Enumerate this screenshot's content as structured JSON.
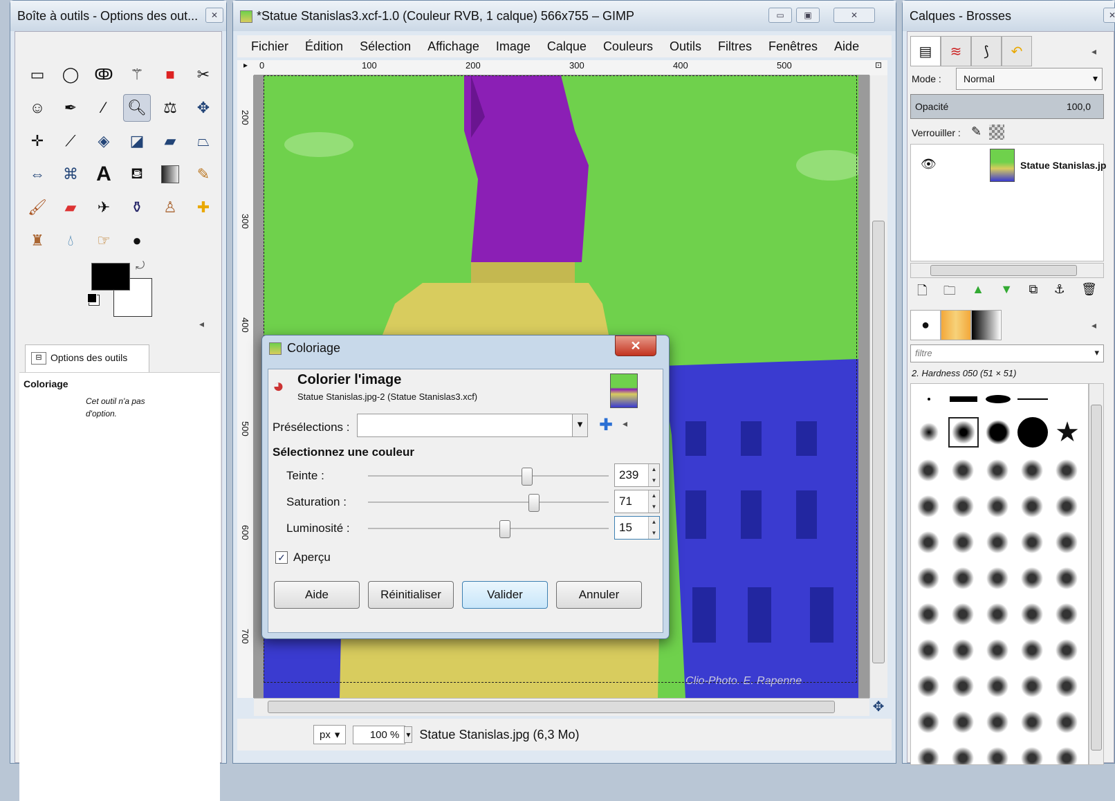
{
  "toolbox": {
    "title": "Boîte à outils - Options des out...",
    "tool_options_tab": "Options des outils",
    "tool_name": "Coloriage",
    "no_options_text": "Cet outil n'a pas d'option.",
    "fg_color": "#000000",
    "bg_color": "#ffffff"
  },
  "main_window": {
    "title": "*Statue Stanislas3.xcf-1.0 (Couleur RVB, 1 calque) 566x755 – GIMP",
    "menus": [
      "Fichier",
      "Édition",
      "Sélection",
      "Affichage",
      "Image",
      "Calque",
      "Couleurs",
      "Outils",
      "Filtres",
      "Fenêtres",
      "Aide"
    ],
    "ruler_h_labels": [
      "0",
      "100",
      "200",
      "300",
      "400",
      "500"
    ],
    "ruler_v_labels": [
      "200",
      "300",
      "400",
      "500",
      "600",
      "700"
    ],
    "unit": "px",
    "zoom": "100 %",
    "status": "Statue Stanislas.jpg (6,3 Mo)",
    "watermark": "Clio-Photo. E. Rapenne"
  },
  "dialog": {
    "title": "Coloriage",
    "heading": "Colorier l'image",
    "subheading": "Statue Stanislas.jpg-2 (Statue Stanislas3.xcf)",
    "presets_label": "Présélections :",
    "presets_value": "",
    "section_label": "Sélectionnez une couleur",
    "sliders": [
      {
        "label": "Teinte :",
        "value": "239",
        "fraction": 0.66
      },
      {
        "label": "Saturation :",
        "value": "71",
        "fraction": 0.69
      },
      {
        "label": "Luminosité :",
        "value": "15",
        "fraction": 0.57
      }
    ],
    "preview_label": "Aperçu",
    "preview_checked": true,
    "buttons": {
      "help": "Aide",
      "reset": "Réinitialiser",
      "ok": "Valider",
      "cancel": "Annuler"
    }
  },
  "dock": {
    "title": "Calques - Brosses",
    "mode_label": "Mode :",
    "mode_value": "Normal",
    "opacity_label": "Opacité",
    "opacity_value": "100,0",
    "lock_label": "Verrouiller :",
    "layer_name": "Statue Stanislas.jp",
    "filter_placeholder": "filtre",
    "brush_name": "2. Hardness 050 (51 × 51)"
  },
  "colors": {
    "sky": "#6fd14c",
    "statue": "#8b1fb5",
    "pedestal": "#d8cc5e",
    "building": "#3a3bd0"
  }
}
